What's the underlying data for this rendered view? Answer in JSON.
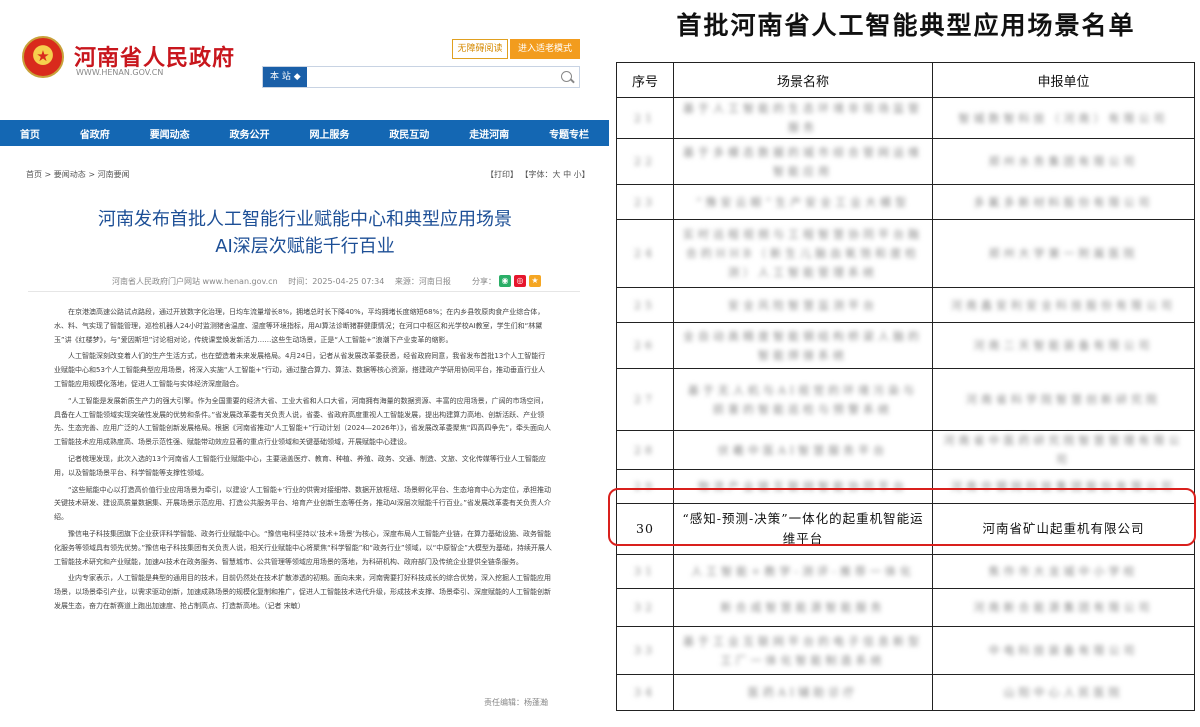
{
  "site": {
    "title": "河南省人民政府",
    "url": "WWW.HENAN.GOV.CN",
    "accessibility_label": "无障碍阅读",
    "elder_mode_label": "进入适老模式",
    "search_scope": "本 站",
    "search_placeholder": ""
  },
  "nav": [
    "首页",
    "省政府",
    "要闻动态",
    "政务公开",
    "网上服务",
    "政民互动",
    "走进河南",
    "专题专栏"
  ],
  "breadcrumb": "首页 > 要闻动态 > 河南要闻",
  "print_tools": "【打印】 【字体：大 中 小】",
  "article": {
    "title_line1": "河南发布首批人工智能行业赋能中心和典型应用场景",
    "title_line2": "AI深层次赋能千行百业",
    "source_site": "河南省人民政府门户网站 www.henan.gov.cn",
    "time": "时间：2025-04-25 07:34",
    "origin": "来源：河南日报",
    "share_label": "分享：",
    "paragraphs": [
      "在京港澳高速公路试点路段，通过开放数字化治理，日均车流量增长8%，拥堵总时长下降40%，平均拥堵长度缩短68%；在内乡县牧原肉食产业综合体，水、料、气实现了智能管理，巡检机器人24小时监测猪舍温度、湿度等环境指标，用AI算法诊断猪群健康情况；在河口中枢区和光学校AI教室，学生们和“林黛玉”讲《红楼梦》，与“爱因斯坦”讨论相对论，传统课堂焕发新活力……这些生动场景，正是“人工智能+”浪潮下产业变革的缩影。",
      "人工智能深刻改变着人们的生产生活方式，也在塑造着未来发展格局。4月24日，记者从省发展改革委获悉，经省政府同意，我省发布首批13个人工智能行业赋能中心和53个人工智能典型应用场景，将深入实施“人工智能+”行动，通过整合算力、算法、数据等核心资源，搭建政产学研用协同平台，推动垂直行业人工智能应用规模化落地，促进人工智能与实体经济深度融合。",
      "“人工智能是发展新质生产力的强大引擎。作为全国重要的经济大省、工业大省和人口大省，河南拥有海量的数据资源、丰富的应用场景，广阔的市场空间，具备在人工智能领域实现突破性发展的优势和条件。”省发展改革委有关负责人说，省委、省政府高度重视人工智能发展，提出构建算力高地、创新活跃、产业领先、生态完善、应用广泛的人工智能创新发展格局。根据《河南省推动“人工智能+”行动计划（2024—2026年）》，省发展改革委聚焦“四高四争先”，牵头面向人工智能技术应用成熟度高、场景示范性强、赋能带动效应显著的重点行业领域和关键基础领域，开展赋能中心建设。",
      "记者梳理发现，此次入选的13个河南省人工智能行业赋能中心，主要涵盖医疗、教育、种植、养殖、政务、交通、制造、文旅、文化传媒等行业人工智能应用，以及智能场景平台、科学智能等支撑性领域。",
      "“这些赋能中心以打造高价值行业应用场景为牵引，以建设‘人工智能+’行业的供需对接细带、数据开放枢纽、场景孵化平台、生态培育中心为定位，承担推动关键技术研发、建设高质量数据集、开展场景示范应用、打造公共服务平台、培育产业创新生态等任务，推动AI深层次赋能千行百业。”省发展改革委有关负责人介绍。",
      "豫信电子科技集团旗下企业获评科学智能、政务行业赋能中心。“豫信电科坚持以‘技术+场景’为核心，深度布局人工智能产业链，在算力基础设施、政务智能化服务等领域具有领先优势。”豫信电子科技集团有关负责人说，相关行业赋能中心将聚焦“科学智能”和“政务行业”领域，以“中原智企”大模型为基础，持续开展人工智能技术研究和产业赋能，加速AI技术在政务服务、智慧城市、公共管理等领域应用场景的落地，为科研机构、政府部门及传统企业提供全链条服务。",
      "业内专家表示，人工智能是典型的通用目的技术，目前仍然处在技术扩散渗透的初期。面向未来，河南需要打好科技成长的综合优势，深入挖掘人工智能应用场景，以场景牵引产业，以需求驱动创新，加速成熟场景的规模化复制和推广，促进人工智能技术迭代升级，形成技术支撑、场景牵引、深度赋能的人工智能创新发展生态，奋力在新赛道上跑出加速度、抢占制高点、打造新高地。（记者 宋敏）"
    ],
    "editor": "责任编辑：杨蓬瀚"
  },
  "list": {
    "title": "首批河南省人工智能典型应用场景名单",
    "headers": [
      "序号",
      "场景名称",
      "申报单位"
    ],
    "rows": [
      {
        "no": "21",
        "name": "基于人工智能的生态环境非现场监管服务",
        "org": "智城数智科技（河南）有限公司"
      },
      {
        "no": "22",
        "name": "基于多模态数据的城市综合管网运维智能应用",
        "org": "郑州水务集团有限公司"
      },
      {
        "no": "23",
        "name": "“豫安云眼”生产安全工业大模型",
        "org": "多氟多新材料股份有限公司"
      },
      {
        "no": "24",
        "name": "实时远程视频与工程智慧协同平台融合的HHB（新生儿脑血氧饱和度检测）人工智能管理系统",
        "org": "郑州大学第一附属医院"
      },
      {
        "no": "25",
        "name": "安全风险智慧监测平台",
        "org": "河南鑫安利安全科技股份有限公司"
      },
      {
        "no": "26",
        "name": "全自动高精度智能钢结构桥梁人脑的智能焊接系统",
        "org": "河南二天智能装备有限公司"
      },
      {
        "no": "27",
        "name": "基于无人机与AI视觉的环境污染与损害的智能巡检与预警系统",
        "org": "河南省科学院智慧创新研究院"
      },
      {
        "no": "28",
        "name": "伏羲中医AI智慧服务平台",
        "org": "河南省中医药研究院智慧管理有限公司"
      },
      {
        "no": "29",
        "name": "物流产业链互联网智能协同平台",
        "org": "河南中钢网科技集团股份有限公司"
      },
      {
        "no": "30",
        "name": "“感知-预测-决策”一体化的起重机智能运维平台",
        "org": "河南省矿山起重机有限公司"
      },
      {
        "no": "31",
        "name": "人工智能+教学-测评-推荐一体化",
        "org": "焦作市大龙城中小学校"
      },
      {
        "no": "32",
        "name": "新合成智慧能源智能服务",
        "org": "河南新合能源集团有限公司"
      },
      {
        "no": "33",
        "name": "基于工业互联网平台的电子信息新型工厂一体化智能制造系统",
        "org": "中电科技装备有限公司"
      },
      {
        "no": "34",
        "name": "医药AI辅助诊疗",
        "org": "山阳中心人民医院"
      }
    ]
  }
}
